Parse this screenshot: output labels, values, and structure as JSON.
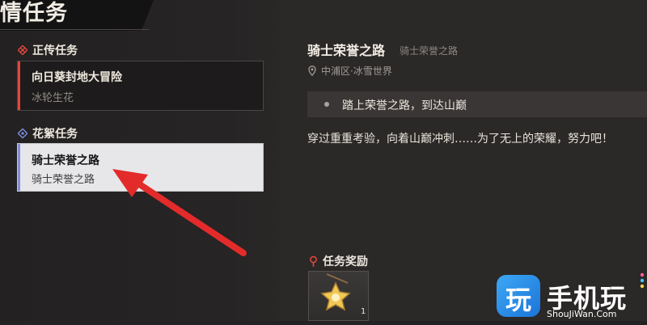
{
  "page": {
    "title": "情任务"
  },
  "sections": {
    "main_story": {
      "label": "正传任务"
    },
    "side_story": {
      "label": "花絮任务"
    }
  },
  "quests": {
    "main": {
      "title": "向日葵封地大冒险",
      "subtitle": "冰轮生花"
    },
    "selected": {
      "title": "骑士荣誉之路",
      "subtitle": "骑士荣誉之路"
    }
  },
  "detail": {
    "title": "骑士荣誉之路",
    "subtitle": "骑士荣誉之路",
    "location": "中浦区·冰雪世界",
    "objective": "踏上荣誉之路，到达山巅",
    "description": "穿过重重考验，向着山巅冲刺……为了无上的荣耀，努力吧！"
  },
  "rewards": {
    "label": "任务奖励",
    "items": [
      {
        "icon": "star-badge-icon",
        "count": "1"
      }
    ]
  },
  "watermark": {
    "glyph": "玩",
    "name": "手机玩",
    "url": "ShouJiWan.Com"
  },
  "colors": {
    "accent_red": "#e0463c",
    "side_blue": "#7e8fe0",
    "arrow_red": "#e32b2b"
  }
}
